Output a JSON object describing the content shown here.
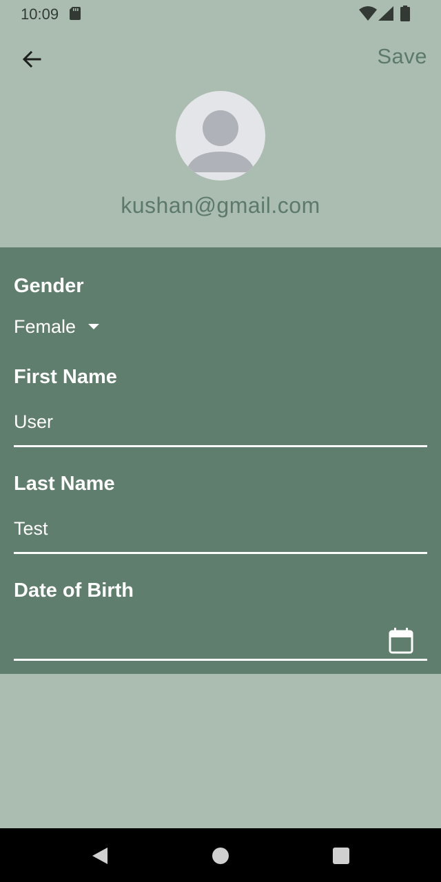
{
  "status_bar": {
    "time": "10:09"
  },
  "app_bar": {
    "back_icon": "arrow-back-icon",
    "save_label": "Save"
  },
  "profile": {
    "avatar_icon": "person-placeholder-icon",
    "email": "kushan@gmail.com"
  },
  "form": {
    "gender": {
      "label": "Gender",
      "value": "Female"
    },
    "first_name": {
      "label": "First Name",
      "value": "User"
    },
    "last_name": {
      "label": "Last Name",
      "value": "Test"
    },
    "date_of_birth": {
      "label": "Date of Birth",
      "value": "",
      "icon": "calendar-icon"
    }
  },
  "colors": {
    "background": "#abbcb0",
    "panel": "#607e6d",
    "accent": "#5c7a6c",
    "text_on_panel": "#ffffff"
  },
  "nav_bar": {
    "icons": [
      "nav-back-icon",
      "nav-home-icon",
      "nav-recents-icon"
    ]
  }
}
